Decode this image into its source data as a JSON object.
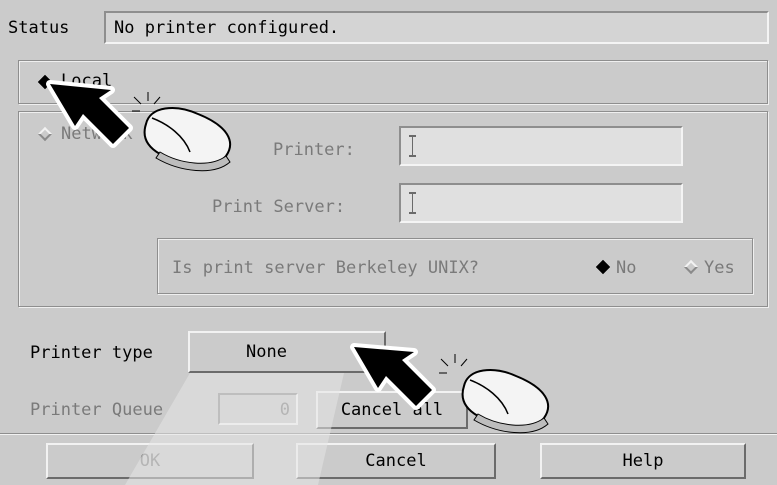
{
  "status": {
    "label": "Status",
    "value": "No printer configured."
  },
  "connection": {
    "local_label": "Local",
    "network_label": "Network",
    "printer_label": "Printer:",
    "printer_value": "",
    "server_label": "Print Server:",
    "server_value": "",
    "berkeley_question": "Is print server Berkeley UNIX?",
    "berkeley_no": "No",
    "berkeley_yes": "Yes"
  },
  "printer_type": {
    "label": "Printer type",
    "value": "None"
  },
  "queue": {
    "label": "Printer Queue",
    "value": "0",
    "cancel_all": "Cancel all"
  },
  "buttons": {
    "ok": "OK",
    "cancel": "Cancel",
    "help": "Help"
  },
  "icons": [
    "pointer-arrow-icon",
    "mouse-click-icon",
    "radio-selected-icon",
    "radio-unselected-icon",
    "option-menu-indicator-icon"
  ]
}
